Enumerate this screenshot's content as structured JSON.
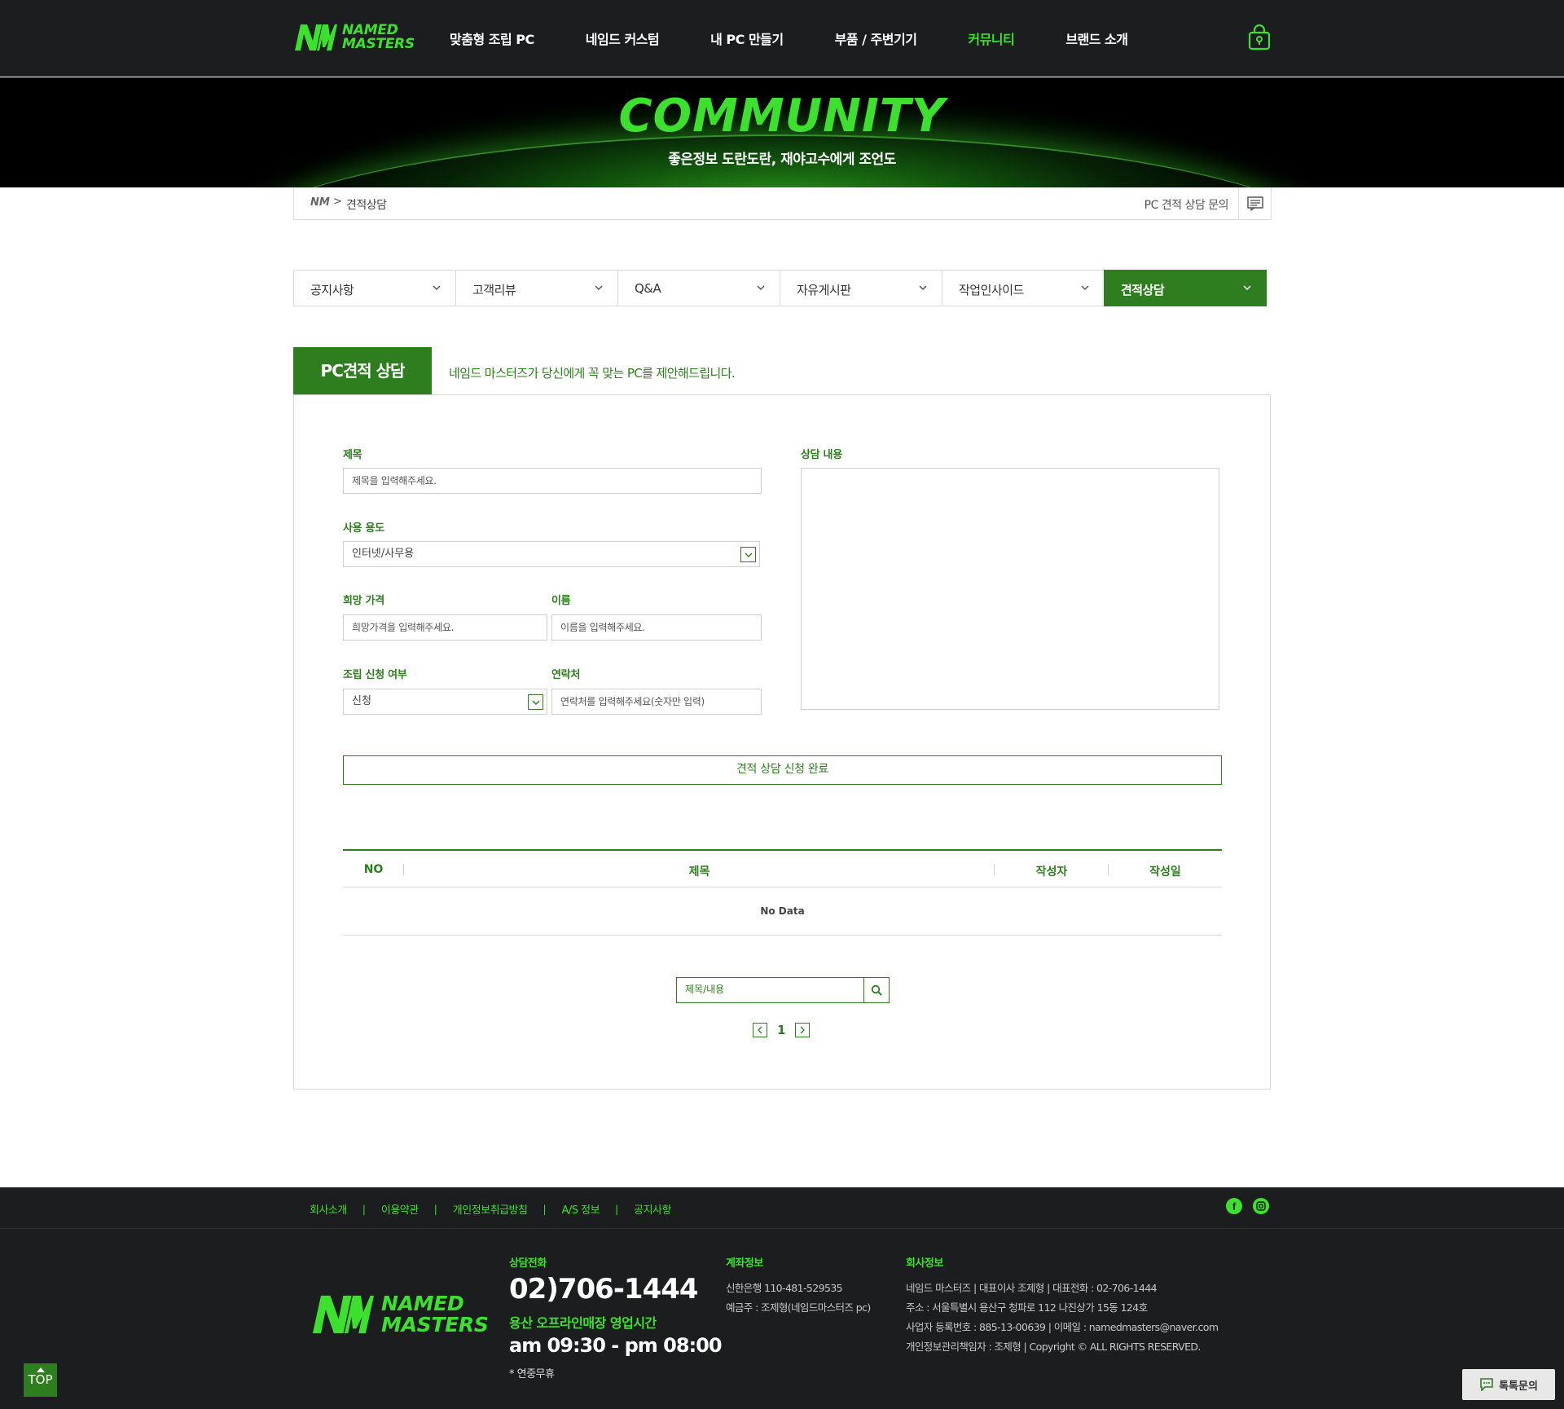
{
  "header": {
    "logo_line1": "NAMED",
    "logo_line2": "MASTERS",
    "nav": [
      "맞춤형 조립 PC",
      "네임드 커스텀",
      "내 PC 만들기",
      "부품 / 주변기기",
      "커뮤니티",
      "브랜드 소개"
    ],
    "active_nav": "커뮤니티",
    "cart_icon": "shopping-bag-icon"
  },
  "hero": {
    "title": "COMMUNITY",
    "subtitle": "좋은정보 도란도란, 재야고수에게 조언도"
  },
  "breadcrumb": {
    "home": "NM",
    "separator": ">",
    "current": "견적상담",
    "right_link": "PC 견적 상담 문의",
    "chat_icon": "chat-icon"
  },
  "tabs": [
    {
      "label": "공지사항",
      "active": false
    },
    {
      "label": "고객리뷰",
      "active": false
    },
    {
      "label": "Q&A",
      "active": false
    },
    {
      "label": "자유게시판",
      "active": false
    },
    {
      "label": "작업인사이드",
      "active": false
    },
    {
      "label": "견적상담",
      "active": true
    }
  ],
  "section": {
    "title": "PC견적 상담",
    "description": "네임드 마스터즈가 당신에게 꼭 맞는 PC를 제안해드립니다."
  },
  "form": {
    "title_label": "제목",
    "title_placeholder": "제목을 입력해주세요.",
    "usage_label": "사용 용도",
    "usage_value": "인터넷/사무용",
    "price_label": "희망 가격",
    "price_placeholder": "희망가격을 입력해주세요.",
    "name_label": "이름",
    "name_placeholder": "이름을 입력해주세요.",
    "assembly_label": "조립 신청 여부",
    "assembly_value": "신청",
    "contact_label": "연락처",
    "contact_placeholder": "연락처를 입력해주세요(숫자만 입력)",
    "content_label": "상담 내용",
    "submit_label": "견적 상담 신청 완료"
  },
  "table": {
    "columns": [
      "NO",
      "제목",
      "작성자",
      "작성일"
    ],
    "empty_text": "No Data"
  },
  "search": {
    "placeholder": "제목/내용",
    "icon": "search-icon"
  },
  "pagination": {
    "current_page": "1"
  },
  "footer": {
    "links": [
      "회사소개",
      "이용약관",
      "개인정보취급방침",
      "A/S 정보",
      "공지사항"
    ],
    "divider": "|",
    "sns": [
      "facebook-icon",
      "instagram-icon"
    ],
    "logo_line1": "NAMED",
    "logo_line2": "MASTERS",
    "phone_label": "상담전화",
    "phone": "02)706-1444",
    "hours_label": "용산 오프라인매장 영업시간",
    "hours": "am 09:30 - pm 08:00",
    "holiday": "* 연중무휴",
    "account_label": "계좌정보",
    "account_line1": "신한은행 110-481-529535",
    "account_line2": "예금주 : 조제형(네임드마스터즈 pc)",
    "company_label": "회사정보",
    "company_line1": "네임드 마스터즈   |   대표이사 조제형   |   대표전화 : 02-706-1444",
    "company_line2": "주소 : 서울특별시 용산구 청파로 112 나진상가 15동 124호",
    "company_line3": "사업자 등록번호 : 885-13-00639   |   이메일 : namedmasters@naver.com",
    "company_line4": "개인정보관리책임자 : 조제형   |   Copyright © ALL RIGHTS RESERVED."
  },
  "floating": {
    "top_label": "TOP",
    "talk_label": "톡톡문의"
  },
  "colors": {
    "brand_green": "#3ee02f",
    "dark_green": "#2e7d1f",
    "header_bg": "#1c1d1e"
  }
}
